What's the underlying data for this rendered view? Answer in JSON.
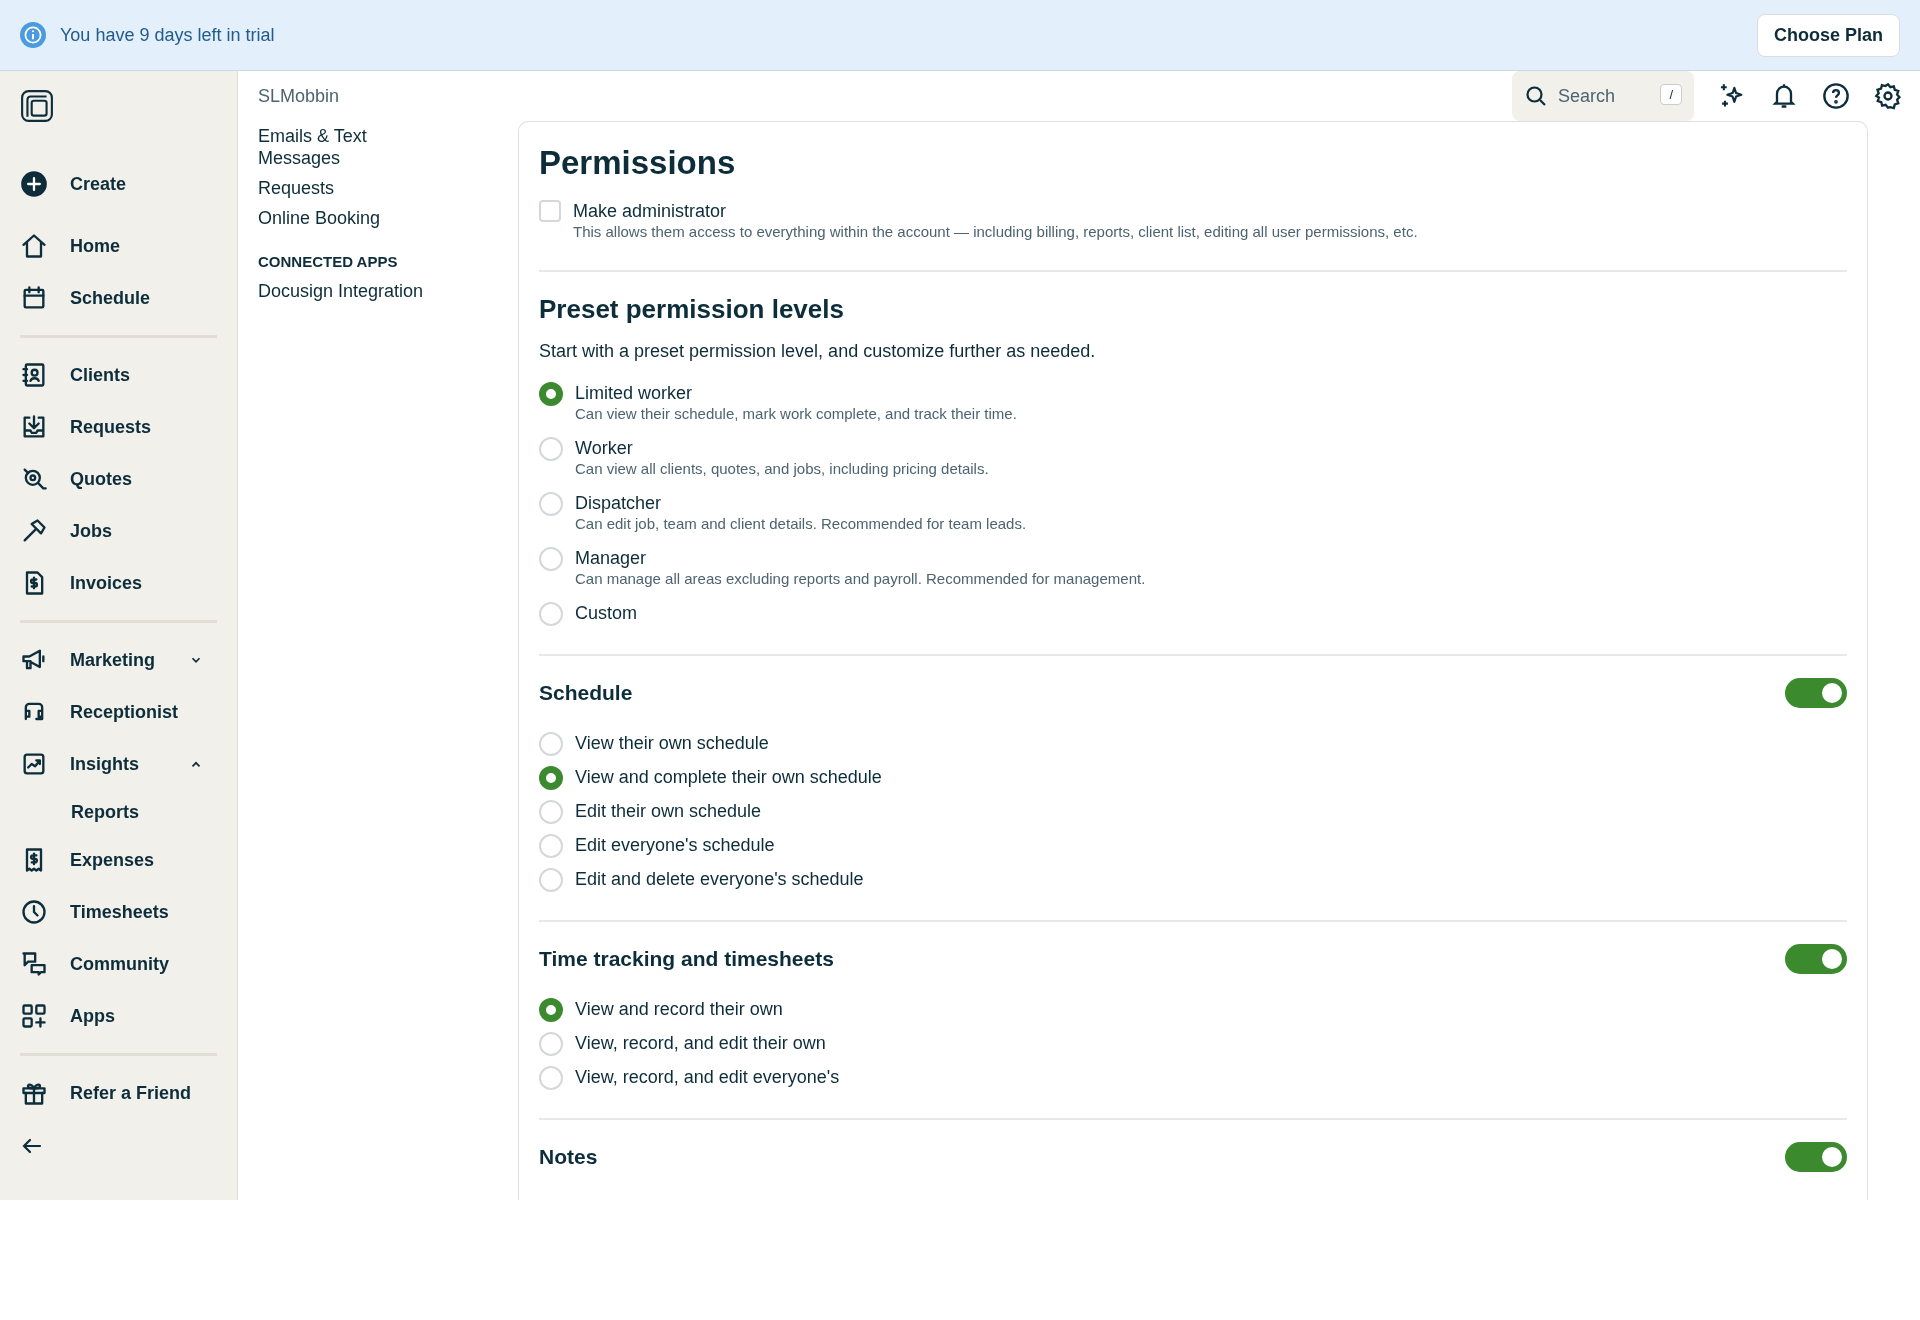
{
  "trial_banner": {
    "message": "You have 9 days left in trial",
    "button": "Choose Plan"
  },
  "sidebar": {
    "groups": [
      [
        {
          "kind": "item",
          "label": "Create",
          "selected": false
        }
      ],
      [
        {
          "kind": "item",
          "label": "Home",
          "selected": false
        },
        {
          "kind": "item",
          "label": "Schedule",
          "selected": false
        }
      ],
      [
        {
          "kind": "item",
          "label": "Clients",
          "selected": false
        },
        {
          "kind": "item",
          "label": "Requests",
          "selected": false
        },
        {
          "kind": "item",
          "label": "Quotes",
          "selected": false
        },
        {
          "kind": "item",
          "label": "Jobs",
          "selected": false
        },
        {
          "kind": "item",
          "label": "Invoices",
          "selected": false
        }
      ],
      [
        {
          "kind": "item",
          "label": "Marketing",
          "selected": false,
          "expanded": false
        },
        {
          "kind": "item",
          "label": "Receptionist",
          "selected": false
        },
        {
          "kind": "item",
          "label": "Insights",
          "selected": false,
          "expanded": true
        },
        {
          "kind": "subitem",
          "label": "Reports",
          "selected": false
        },
        {
          "kind": "item",
          "label": "Expenses",
          "selected": false
        },
        {
          "kind": "item",
          "label": "Timesheets",
          "selected": false
        },
        {
          "kind": "item",
          "label": "Community",
          "selected": false
        },
        {
          "kind": "item",
          "label": "Apps",
          "selected": false
        }
      ],
      [
        {
          "kind": "item",
          "label": "Refer a Friend",
          "selected": false
        }
      ]
    ]
  },
  "account_name": "SLMobbin",
  "settings_nav": [
    {
      "kind": "link",
      "label": "Emails & Text Messages"
    },
    {
      "kind": "link",
      "label": "Requests"
    },
    {
      "kind": "link",
      "label": "Online Booking"
    },
    {
      "kind": "heading",
      "label": "CONNECTED APPS"
    },
    {
      "kind": "link",
      "label": "Docusign Integration"
    }
  ],
  "search": {
    "placeholder": "Search",
    "shortcut": "/"
  },
  "permissions": {
    "title": "Permissions",
    "admin": {
      "label": "Make administrator",
      "description": "This allows them access to everything within the account — including billing, reports, client list, editing all user permissions, etc.",
      "checked": false
    },
    "preset": {
      "title": "Preset permission levels",
      "intro": "Start with a preset permission level, and customize further as needed.",
      "options": [
        {
          "label": "Limited worker",
          "description": "Can view their schedule, mark work complete, and track their time.",
          "selected": true
        },
        {
          "label": "Worker",
          "description": "Can view all clients, quotes, and jobs, including pricing details.",
          "selected": false
        },
        {
          "label": "Dispatcher",
          "description": "Can edit job, team and client details. Recommended for team leads.",
          "selected": false
        },
        {
          "label": "Manager",
          "description": "Can manage all areas excluding reports and payroll. Recommended for management.",
          "selected": false
        },
        {
          "label": "Custom",
          "selected": false
        }
      ]
    },
    "sections": [
      {
        "title": "Schedule",
        "on": true,
        "options": [
          {
            "label": "View their own schedule",
            "selected": false
          },
          {
            "label": "View and complete their own schedule",
            "selected": true
          },
          {
            "label": "Edit their own schedule",
            "selected": false
          },
          {
            "label": "Edit everyone's schedule",
            "selected": false
          },
          {
            "label": "Edit and delete everyone's schedule",
            "selected": false
          }
        ]
      },
      {
        "title": "Time tracking and timesheets",
        "on": true,
        "options": [
          {
            "label": "View and record their own",
            "selected": true
          },
          {
            "label": "View, record, and edit their own",
            "selected": false
          },
          {
            "label": "View, record, and edit everyone's",
            "selected": false
          }
        ]
      },
      {
        "title": "Notes",
        "on": true
      }
    ]
  }
}
